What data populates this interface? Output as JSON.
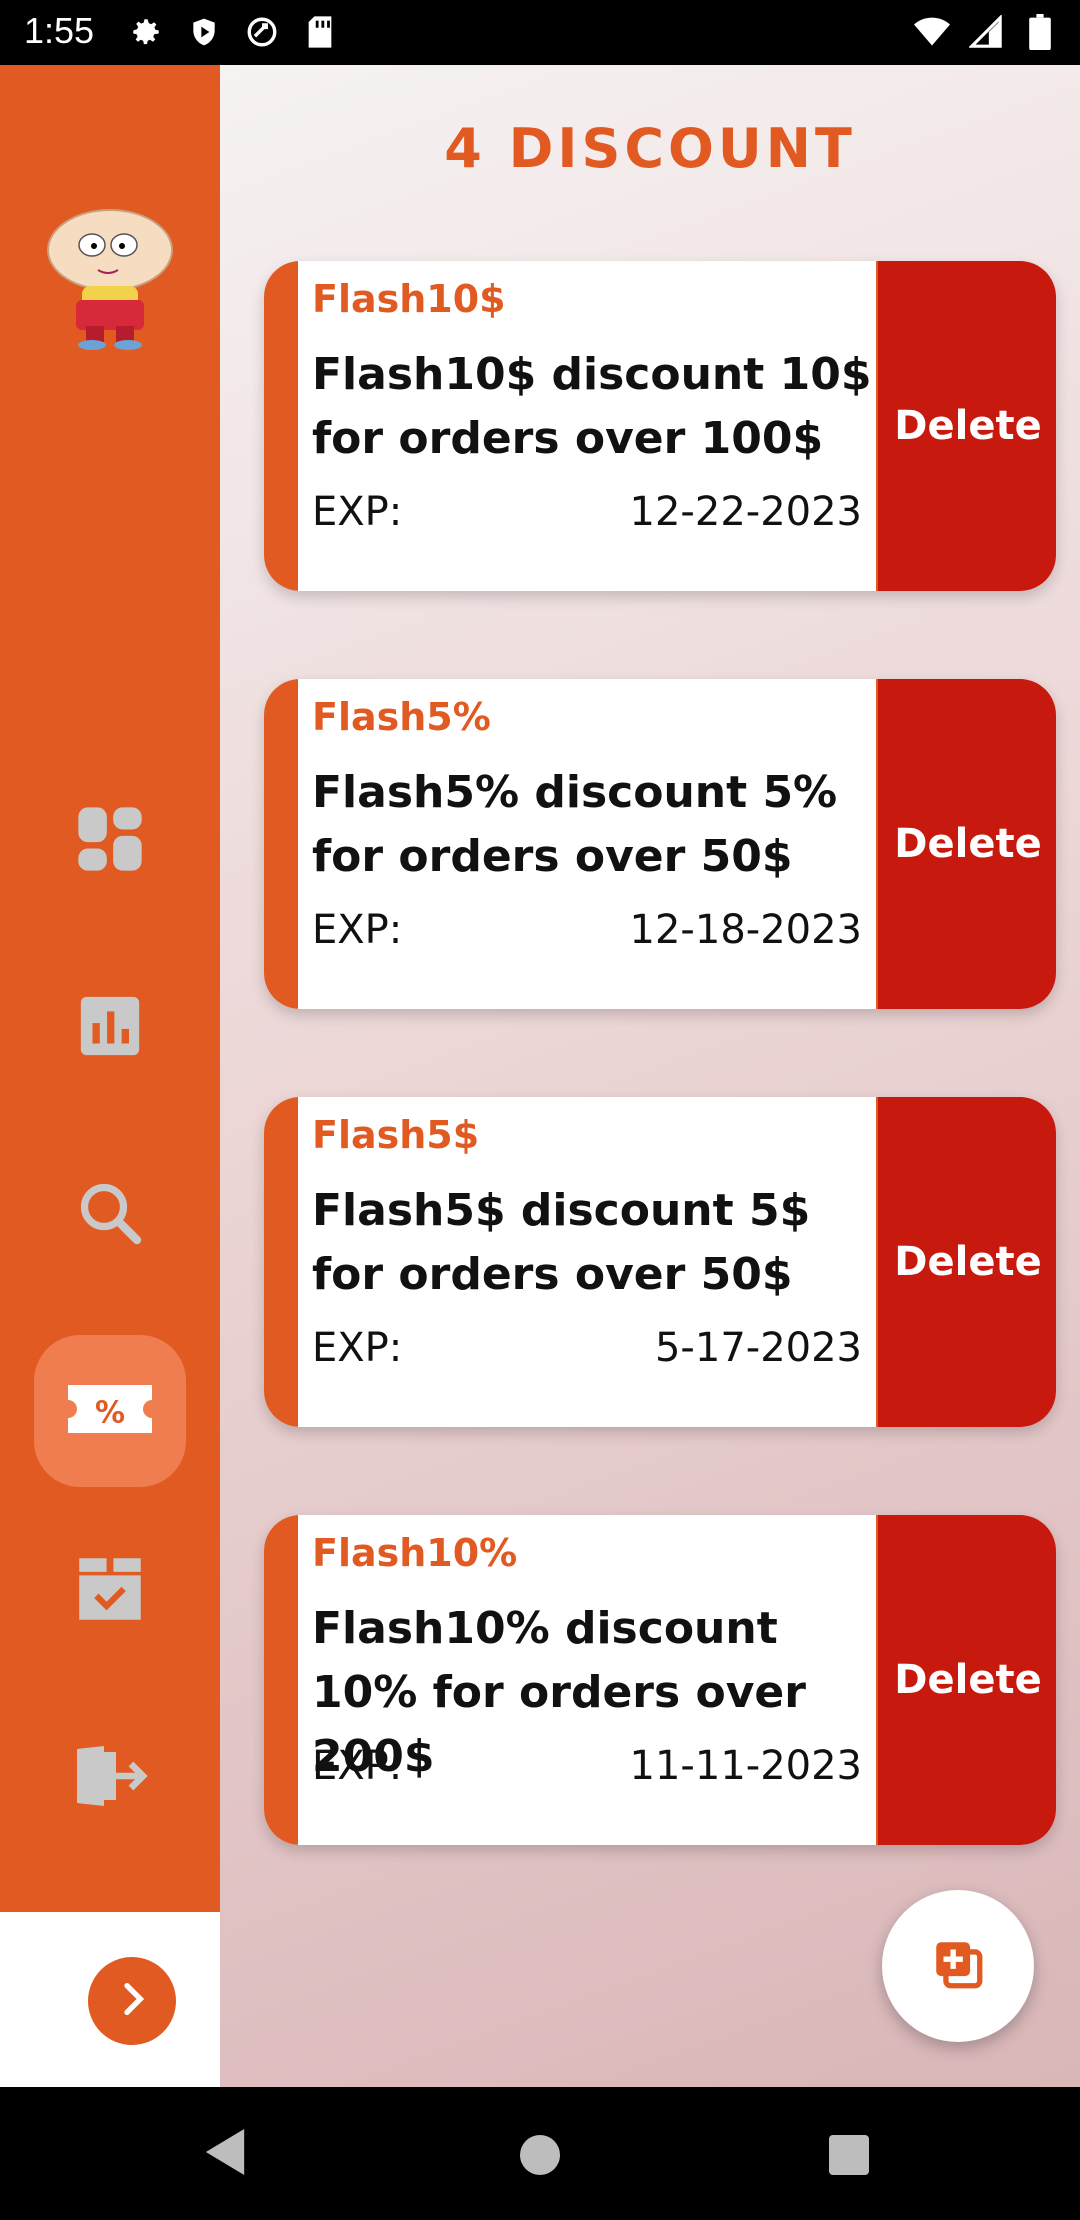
{
  "status_bar": {
    "time": "1:55",
    "left_icons": [
      "settings-icon",
      "shield-play-icon",
      "sync-icon",
      "sd-card-icon"
    ],
    "right_icons": [
      "wifi-icon",
      "signal-icon",
      "battery-icon"
    ]
  },
  "page": {
    "title": "4 DISCOUNT"
  },
  "sidebar": {
    "avatar": "avatar-character",
    "items": [
      {
        "icon": "dashboard-icon",
        "active": false
      },
      {
        "icon": "bar-chart-icon",
        "active": false
      },
      {
        "icon": "search-icon",
        "active": false
      },
      {
        "icon": "discount-ticket-icon",
        "active": true
      },
      {
        "icon": "package-check-icon",
        "active": false
      },
      {
        "icon": "logout-icon",
        "active": false
      }
    ],
    "expand_icon": "chevron-right-icon"
  },
  "discounts": [
    {
      "code": "Flash10$",
      "description": "Flash10$ discount 10$ for orders over 100$",
      "exp_label": "EXP:",
      "exp_date": "12-22-2023",
      "delete_label": "Delete"
    },
    {
      "code": "Flash5%",
      "description": "Flash5% discount 5% for orders over 50$",
      "exp_label": "EXP:",
      "exp_date": "12-18-2023",
      "delete_label": "Delete"
    },
    {
      "code": "Flash5$",
      "description": "Flash5$ discount 5$ for orders over 50$",
      "exp_label": "EXP:",
      "exp_date": "5-17-2023",
      "delete_label": "Delete"
    },
    {
      "code": "Flash10%",
      "description": "Flash10% discount 10% for orders over 200$",
      "exp_label": "EXP:",
      "exp_date": "11-11-2023",
      "delete_label": "Delete"
    }
  ],
  "fab": {
    "icon": "add-copy-icon"
  },
  "colors": {
    "primary": "#e15a22",
    "delete": "#c8190f",
    "active_nav": "#f07d4f"
  }
}
